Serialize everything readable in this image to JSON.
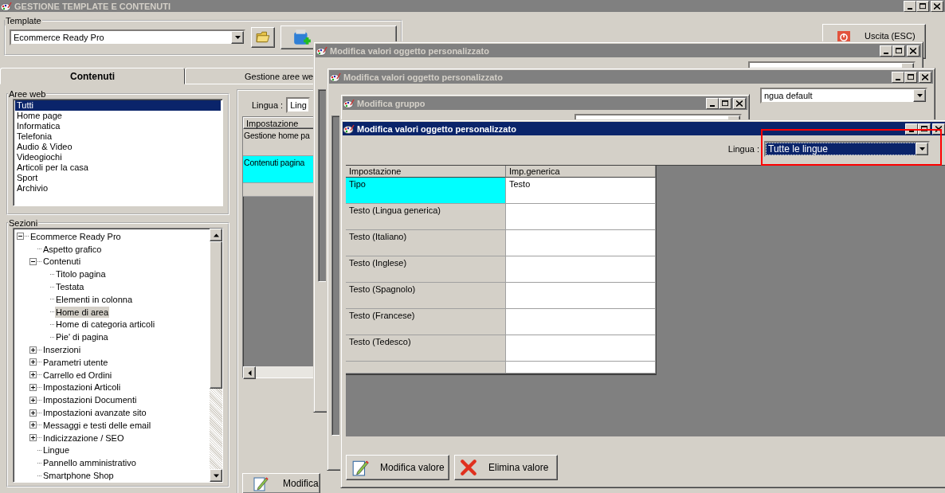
{
  "main_window": {
    "title": "GESTIONE TEMPLATE E CONTENUTI",
    "template": {
      "label": "Template",
      "value": "Ecommerce Ready Pro"
    },
    "exit_button": "Uscita (ESC)",
    "tabs": [
      {
        "label": "Contenuti",
        "selected": true
      },
      {
        "label": "Gestione aree we",
        "selected": false
      }
    ],
    "aree_web": {
      "label": "Aree web",
      "items": [
        {
          "label": "Tutti",
          "selected": true
        },
        {
          "label": "Home page",
          "selected": false
        },
        {
          "label": "Informatica",
          "selected": false
        },
        {
          "label": "Telefonia",
          "selected": false
        },
        {
          "label": "Audio & Video",
          "selected": false
        },
        {
          "label": "Videogiochi",
          "selected": false
        },
        {
          "label": "Articoli per la casa",
          "selected": false
        },
        {
          "label": "Sport",
          "selected": false
        },
        {
          "label": "Archivio",
          "selected": false
        }
      ]
    },
    "sezioni": {
      "label": "Sezioni",
      "tree": [
        {
          "label": "Ecommerce Ready Pro",
          "expanded": true,
          "selected": false,
          "children": [
            {
              "label": "Aspetto grafico",
              "selected": false
            },
            {
              "label": "Contenuti",
              "expanded": true,
              "selected": false,
              "children": [
                {
                  "label": "Titolo pagina",
                  "selected": false
                },
                {
                  "label": "Testata",
                  "selected": false
                },
                {
                  "label": "Elementi in colonna",
                  "selected": false
                },
                {
                  "label": "Home di area",
                  "selected": true
                },
                {
                  "label": "Home di categoria articoli",
                  "selected": false
                },
                {
                  "label": "Pie' di pagina",
                  "selected": false
                }
              ]
            },
            {
              "label": "Inserzioni",
              "expanded": false,
              "selected": false
            },
            {
              "label": "Parametri utente",
              "expanded": false,
              "selected": false
            },
            {
              "label": "Carrello ed Ordini",
              "expanded": false,
              "selected": false
            },
            {
              "label": "Impostazioni Articoli",
              "expanded": false,
              "selected": false
            },
            {
              "label": "Impostazioni Documenti",
              "expanded": false,
              "selected": false
            },
            {
              "label": "Impostazioni avanzate sito",
              "expanded": false,
              "selected": false
            },
            {
              "label": "Messaggi e testi delle email",
              "expanded": false,
              "selected": false
            },
            {
              "label": "Indicizzazione / SEO",
              "expanded": false,
              "selected": false
            },
            {
              "label": "Lingue",
              "selected": false
            },
            {
              "label": "Pannello amministrativo",
              "selected": false
            },
            {
              "label": "Smartphone Shop",
              "selected": false
            }
          ]
        }
      ]
    },
    "contents": {
      "lingua_label": "Lingua :",
      "lingua_value": "Ling",
      "columns": [
        "Impostazione"
      ],
      "rows": [
        {
          "cells": [
            "Gestione home pa"
          ],
          "highlighted": false
        },
        {
          "cells": [
            "Contenuti pagina"
          ],
          "highlighted": true
        }
      ],
      "buttons": [
        {
          "label": "Modifica",
          "kind": "edit"
        }
      ]
    }
  },
  "background_windows": [
    {
      "title": "Modifica valori oggetto personalizzato"
    },
    {
      "title": "Modifica valori oggetto personalizzato",
      "combo_value": "ngua default"
    },
    {
      "title": "Modifica gruppo"
    }
  ],
  "active_window": {
    "title": "Modifica valori oggetto personalizzato",
    "lingua_label": "Lingua :",
    "lingua_value": "Tutte le lingue",
    "columns": [
      "Impostazione",
      "Imp.generica"
    ],
    "rows": [
      {
        "cells": [
          "Tipo",
          "Testo"
        ],
        "highlighted": true
      },
      {
        "cells": [
          "Testo (Lingua generica)"
        ],
        "highlighted": false
      },
      {
        "cells": [
          "Testo (Italiano)"
        ],
        "highlighted": false
      },
      {
        "cells": [
          "Testo (Inglese)"
        ],
        "highlighted": false
      },
      {
        "cells": [
          "Testo (Spagnolo)"
        ],
        "highlighted": false
      },
      {
        "cells": [
          "Testo (Francese)"
        ],
        "highlighted": false
      },
      {
        "cells": [
          "Testo (Tedesco)"
        ],
        "highlighted": false
      }
    ],
    "buttons": [
      {
        "label": "Modifica valore",
        "kind": "edit"
      },
      {
        "label": "Elimina valore",
        "kind": "delete"
      }
    ]
  }
}
